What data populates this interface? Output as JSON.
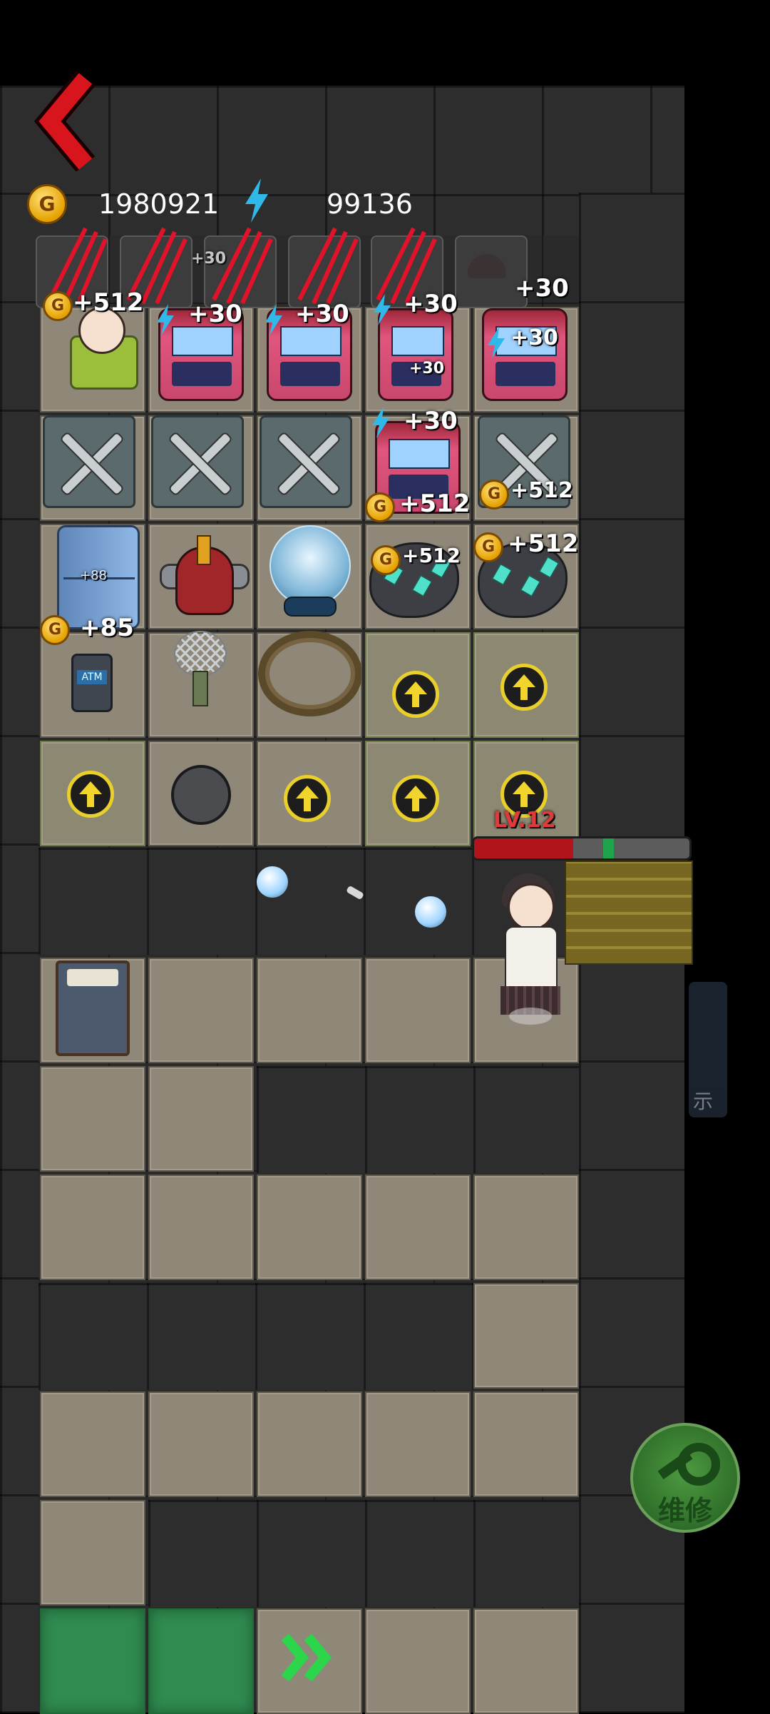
{
  "hud": {
    "gold_icon_letter": "G",
    "gold": "1980921",
    "energy": "99136",
    "back_icon": "chevron-left-icon"
  },
  "portraits_row": {
    "labels": [
      "+512",
      "+30",
      "+30",
      "+30",
      "+30",
      "+30"
    ],
    "sub_label": "+30"
  },
  "row1": {
    "bed_label": "+512",
    "arcade_labels": [
      "+30",
      "+30",
      "+30",
      "+30"
    ],
    "arcade_inner_label": "+30"
  },
  "row2": {
    "arcade_label": "+30",
    "coin_label_1": "+512",
    "coin_label_2": "+512"
  },
  "row3": {
    "fridge_label": "+85",
    "fridge_inner": "+88",
    "rock_label_1": "+512",
    "rock_label_2": "+512"
  },
  "row4": {
    "atm_label": "ATM"
  },
  "enemy": {
    "level": "LV.12",
    "hp_fraction": 0.46,
    "shield_fraction": 0.05
  },
  "side_panel": {
    "hint_char": "示"
  },
  "repair_button": {
    "label": "维修"
  },
  "colors": {
    "accent_red": "#c7121a",
    "coin_gold": "#f0b400",
    "energy_blue": "#2fb8e8",
    "upgrade_yellow": "#e8cf2b",
    "grass_green": "#2f8b4f",
    "repair_green": "#3f8a38"
  }
}
